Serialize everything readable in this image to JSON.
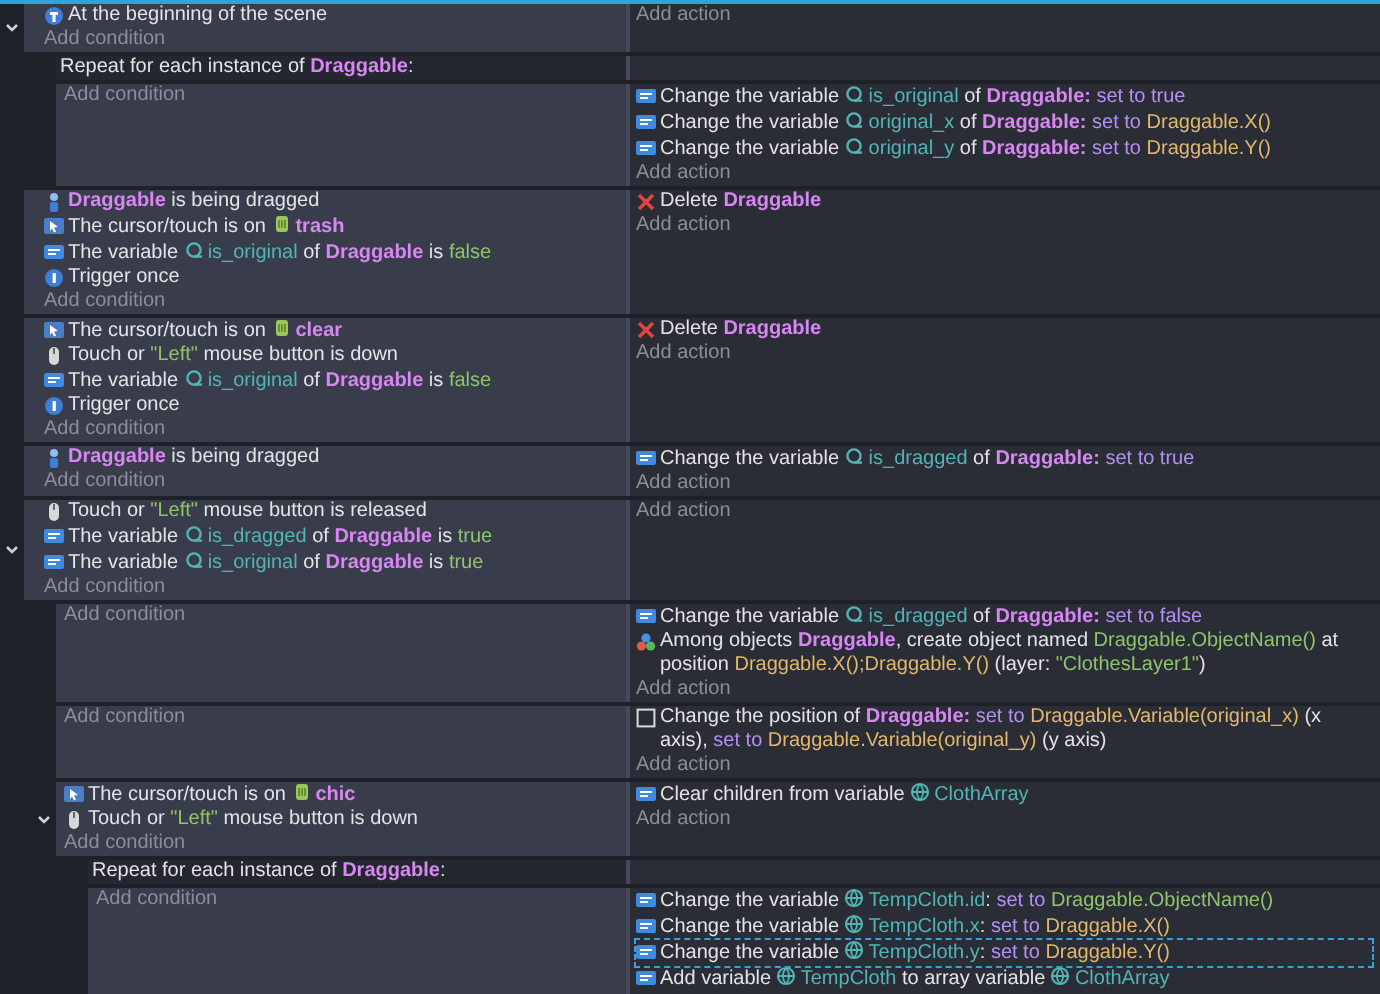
{
  "events": [
    {
      "kind": "standard",
      "expanded": true,
      "add_condition": "Add condition",
      "add_action": "Add action",
      "conditions": [
        {
          "kind": "scene_start",
          "parts": [
            {
              "kind": "plain",
              "text": "At the beginning of the scene"
            }
          ]
        }
      ],
      "children": [
        {
          "kind": "repeat",
          "header": [
            {
              "kind": "plain",
              "text": "Repeat for each instance of "
            },
            {
              "kind": "object",
              "text": "Draggable"
            },
            {
              "kind": "plain",
              "text": ":"
            }
          ],
          "add_condition": "Add condition",
          "add_action": "Add action",
          "actions": [
            {
              "kind": "variable",
              "selected": false,
              "parts": [
                {
                  "kind": "plain",
                  "text": "Change the variable "
                },
                {
                  "kind": "object_variable",
                  "text": "is_original"
                },
                {
                  "kind": "plain",
                  "text": " of "
                },
                {
                  "kind": "object",
                  "text": "Draggable:"
                },
                {
                  "kind": "operator",
                  "text": " set to true"
                }
              ]
            },
            {
              "kind": "variable",
              "selected": false,
              "parts": [
                {
                  "kind": "plain",
                  "text": "Change the variable "
                },
                {
                  "kind": "object_variable",
                  "text": "original_x"
                },
                {
                  "kind": "plain",
                  "text": " of "
                },
                {
                  "kind": "object",
                  "text": "Draggable:"
                },
                {
                  "kind": "operator",
                  "text": " set to "
                },
                {
                  "kind": "expression",
                  "text": "Draggable.X()"
                }
              ]
            },
            {
              "kind": "variable",
              "selected": false,
              "parts": [
                {
                  "kind": "plain",
                  "text": "Change the variable "
                },
                {
                  "kind": "object_variable",
                  "text": "original_y"
                },
                {
                  "kind": "plain",
                  "text": " of "
                },
                {
                  "kind": "object",
                  "text": "Draggable:"
                },
                {
                  "kind": "operator",
                  "text": " set to "
                },
                {
                  "kind": "expression",
                  "text": "Draggable.Y()"
                }
              ]
            }
          ]
        }
      ]
    },
    {
      "kind": "standard",
      "add_condition": "Add condition",
      "add_action": "Add action",
      "conditions": [
        {
          "kind": "drag",
          "parts": [
            {
              "kind": "object",
              "text": "Draggable"
            },
            {
              "kind": "plain",
              "text": " is being dragged"
            }
          ]
        },
        {
          "kind": "cursor",
          "parts": [
            {
              "kind": "plain",
              "text": "The cursor/touch is on "
            },
            {
              "kind": "sprite",
              "text": "trash"
            }
          ]
        },
        {
          "kind": "variable",
          "parts": [
            {
              "kind": "plain",
              "text": "The variable "
            },
            {
              "kind": "object_variable",
              "text": "is_original"
            },
            {
              "kind": "plain",
              "text": " of "
            },
            {
              "kind": "object",
              "text": "Draggable"
            },
            {
              "kind": "plain",
              "text": " is "
            },
            {
              "kind": "value",
              "text": "false"
            }
          ]
        },
        {
          "kind": "trigger",
          "parts": [
            {
              "kind": "plain",
              "text": "Trigger once"
            }
          ]
        }
      ],
      "actions": [
        {
          "kind": "delete",
          "selected": false,
          "parts": [
            {
              "kind": "plain",
              "text": "Delete "
            },
            {
              "kind": "object",
              "text": "Draggable"
            }
          ]
        }
      ]
    },
    {
      "kind": "standard",
      "add_condition": "Add condition",
      "add_action": "Add action",
      "conditions": [
        {
          "kind": "cursor",
          "parts": [
            {
              "kind": "plain",
              "text": "The cursor/touch is on "
            },
            {
              "kind": "sprite",
              "text": "clear"
            }
          ]
        },
        {
          "kind": "mouse",
          "parts": [
            {
              "kind": "plain",
              "text": "Touch or "
            },
            {
              "kind": "value",
              "text": "\"Left\""
            },
            {
              "kind": "plain",
              "text": " mouse button is down"
            }
          ]
        },
        {
          "kind": "variable",
          "parts": [
            {
              "kind": "plain",
              "text": "The variable "
            },
            {
              "kind": "object_variable",
              "text": "is_original"
            },
            {
              "kind": "plain",
              "text": " of "
            },
            {
              "kind": "object",
              "text": "Draggable"
            },
            {
              "kind": "plain",
              "text": " is "
            },
            {
              "kind": "value",
              "text": "false"
            }
          ]
        },
        {
          "kind": "trigger",
          "parts": [
            {
              "kind": "plain",
              "text": "Trigger once"
            }
          ]
        }
      ],
      "actions": [
        {
          "kind": "delete",
          "selected": false,
          "parts": [
            {
              "kind": "plain",
              "text": "Delete "
            },
            {
              "kind": "object",
              "text": "Draggable"
            }
          ]
        }
      ]
    },
    {
      "kind": "standard",
      "add_condition": "Add condition",
      "add_action": "Add action",
      "conditions": [
        {
          "kind": "drag",
          "parts": [
            {
              "kind": "object",
              "text": "Draggable"
            },
            {
              "kind": "plain",
              "text": " is being dragged"
            }
          ]
        }
      ],
      "actions": [
        {
          "kind": "variable",
          "selected": false,
          "parts": [
            {
              "kind": "plain",
              "text": "Change the variable "
            },
            {
              "kind": "object_variable",
              "text": "is_dragged"
            },
            {
              "kind": "plain",
              "text": " of "
            },
            {
              "kind": "object",
              "text": "Draggable:"
            },
            {
              "kind": "operator",
              "text": " set to true"
            }
          ]
        }
      ]
    },
    {
      "kind": "standard",
      "expanded": true,
      "add_condition": "Add condition",
      "add_action": "Add action",
      "conditions": [
        {
          "kind": "mouse",
          "parts": [
            {
              "kind": "plain",
              "text": "Touch or "
            },
            {
              "kind": "value",
              "text": "\"Left\""
            },
            {
              "kind": "plain",
              "text": " mouse button is released"
            }
          ]
        },
        {
          "kind": "variable",
          "parts": [
            {
              "kind": "plain",
              "text": "The variable "
            },
            {
              "kind": "object_variable",
              "text": "is_dragged"
            },
            {
              "kind": "plain",
              "text": " of "
            },
            {
              "kind": "object",
              "text": "Draggable"
            },
            {
              "kind": "plain",
              "text": " is "
            },
            {
              "kind": "value",
              "text": "true"
            }
          ]
        },
        {
          "kind": "variable",
          "parts": [
            {
              "kind": "plain",
              "text": "The variable "
            },
            {
              "kind": "object_variable",
              "text": "is_original"
            },
            {
              "kind": "plain",
              "text": " of "
            },
            {
              "kind": "object",
              "text": "Draggable"
            },
            {
              "kind": "plain",
              "text": " is "
            },
            {
              "kind": "value",
              "text": "true"
            }
          ]
        }
      ],
      "children": [
        {
          "kind": "standard",
          "add_condition": "Add condition",
          "add_action": "Add action",
          "actions": [
            {
              "kind": "variable",
              "selected": false,
              "parts": [
                {
                  "kind": "plain",
                  "text": "Change the variable "
                },
                {
                  "kind": "object_variable",
                  "text": "is_dragged"
                },
                {
                  "kind": "plain",
                  "text": " of "
                },
                {
                  "kind": "object",
                  "text": "Draggable:"
                },
                {
                  "kind": "operator",
                  "text": " set to false"
                }
              ]
            },
            {
              "kind": "create",
              "selected": false,
              "parts": [
                {
                  "kind": "plain",
                  "text": "Among objects "
                },
                {
                  "kind": "object",
                  "text": "Draggable"
                },
                {
                  "kind": "plain",
                  "text": ", create object named "
                },
                {
                  "kind": "value",
                  "text": "Draggable.ObjectName()"
                },
                {
                  "kind": "plain",
                  "text": " at position "
                },
                {
                  "kind": "expression",
                  "text": "Draggable.X();Draggable.Y()"
                },
                {
                  "kind": "plain",
                  "text": " (layer: "
                },
                {
                  "kind": "value",
                  "text": "\"ClothesLayer1\""
                },
                {
                  "kind": "plain",
                  "text": ")"
                }
              ]
            }
          ]
        },
        {
          "kind": "standard",
          "add_condition": "Add condition",
          "add_action": "Add action",
          "actions": [
            {
              "kind": "position",
              "selected": false,
              "parts": [
                {
                  "kind": "plain",
                  "text": "Change the position of "
                },
                {
                  "kind": "object",
                  "text": "Draggable:"
                },
                {
                  "kind": "operator",
                  "text": " set to "
                },
                {
                  "kind": "expression",
                  "text": "Draggable.Variable(original_x)"
                },
                {
                  "kind": "plain",
                  "text": " (x axis), "
                },
                {
                  "kind": "operator",
                  "text": "set to "
                },
                {
                  "kind": "expression",
                  "text": "Draggable.Variable(original_y)"
                },
                {
                  "kind": "plain",
                  "text": " (y axis)"
                }
              ]
            }
          ]
        },
        {
          "kind": "standard",
          "expanded": true,
          "add_condition": "Add condition",
          "add_action": "Add action",
          "conditions": [
            {
              "kind": "cursor",
              "parts": [
                {
                  "kind": "plain",
                  "text": "The cursor/touch is on "
                },
                {
                  "kind": "sprite",
                  "text": "chic"
                }
              ]
            },
            {
              "kind": "mouse",
              "parts": [
                {
                  "kind": "plain",
                  "text": "Touch or "
                },
                {
                  "kind": "value",
                  "text": "\"Left\""
                },
                {
                  "kind": "plain",
                  "text": " mouse button is down"
                }
              ]
            }
          ],
          "actions": [
            {
              "kind": "variable",
              "selected": false,
              "parts": [
                {
                  "kind": "plain",
                  "text": "Clear children from variable "
                },
                {
                  "kind": "scene_variable",
                  "text": "ClothArray"
                }
              ]
            }
          ],
          "children": [
            {
              "kind": "repeat",
              "header": [
                {
                  "kind": "plain",
                  "text": "Repeat for each instance of "
                },
                {
                  "kind": "object",
                  "text": "Draggable"
                },
                {
                  "kind": "plain",
                  "text": ":"
                }
              ],
              "add_condition": "Add condition",
              "actions": [
                {
                  "kind": "variable",
                  "selected": false,
                  "parts": [
                    {
                      "kind": "plain",
                      "text": "Change the variable "
                    },
                    {
                      "kind": "scene_variable",
                      "text": "TempCloth.id"
                    },
                    {
                      "kind": "plain",
                      "text": ": "
                    },
                    {
                      "kind": "operator",
                      "text": "set to "
                    },
                    {
                      "kind": "value",
                      "text": "Draggable.ObjectName()"
                    }
                  ]
                },
                {
                  "kind": "variable",
                  "selected": false,
                  "parts": [
                    {
                      "kind": "plain",
                      "text": "Change the variable "
                    },
                    {
                      "kind": "scene_variable",
                      "text": "TempCloth.x"
                    },
                    {
                      "kind": "plain",
                      "text": ": "
                    },
                    {
                      "kind": "operator",
                      "text": "set to "
                    },
                    {
                      "kind": "expression",
                      "text": "Draggable.X()"
                    }
                  ]
                },
                {
                  "kind": "variable",
                  "selected": true,
                  "parts": [
                    {
                      "kind": "plain",
                      "text": "Change the variable "
                    },
                    {
                      "kind": "scene_variable",
                      "text": "TempCloth.y"
                    },
                    {
                      "kind": "plain",
                      "text": ": "
                    },
                    {
                      "kind": "operator",
                      "text": "set to "
                    },
                    {
                      "kind": "expression",
                      "text": "Draggable.Y()"
                    }
                  ]
                },
                {
                  "kind": "variable",
                  "selected": false,
                  "parts": [
                    {
                      "kind": "plain",
                      "text": "Add variable "
                    },
                    {
                      "kind": "scene_variable",
                      "text": "TempCloth"
                    },
                    {
                      "kind": "plain",
                      "text": " to array variable "
                    },
                    {
                      "kind": "scene_variable",
                      "text": "ClothArray"
                    }
                  ]
                }
              ]
            }
          ]
        }
      ]
    }
  ]
}
